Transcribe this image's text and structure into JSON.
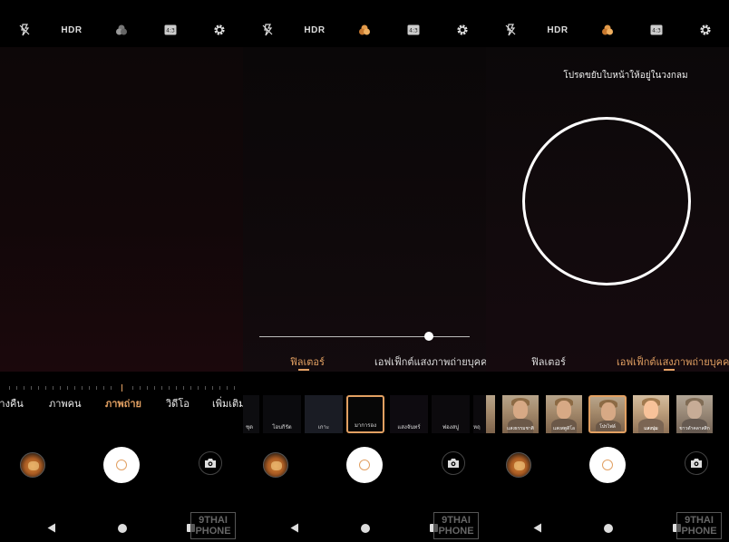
{
  "panel1": {
    "modes": [
      {
        "label": "กลางคืน",
        "active": false
      },
      {
        "label": "ภาพคน",
        "active": false
      },
      {
        "label": "ภาพถ่าย",
        "active": true
      },
      {
        "label": "วิดีโอ",
        "active": false
      },
      {
        "label": "เพิ่มเติม",
        "active": false
      }
    ]
  },
  "panel2": {
    "tabs": [
      {
        "label": "ฟิลเตอร์",
        "active": true
      },
      {
        "label": "เอฟเฟ็กต์แสงภาพถ่ายบุคคล",
        "active": false
      }
    ],
    "slider_value": 0.82,
    "filters": [
      {
        "label": "ชุด",
        "selected": false
      },
      {
        "label": "โอบกิรัต",
        "selected": false
      },
      {
        "label": "เกาะ",
        "selected": false
      },
      {
        "label": "มาการอง",
        "selected": true
      },
      {
        "label": "แสงจันทร์",
        "selected": false
      },
      {
        "label": "ฟองสบู่",
        "selected": false
      },
      {
        "label": "หฤ",
        "selected": false
      }
    ]
  },
  "panel3": {
    "hint": "โปรดขยับใบหน้าให้อยู่ในวงกลม",
    "tabs": [
      {
        "label": "ฟิลเตอร์",
        "active": false
      },
      {
        "label": "เอฟเฟ็กต์แสงภาพถ่ายบุคคล",
        "active": true
      }
    ],
    "portraits": [
      {
        "label": "",
        "selected": false
      },
      {
        "label": "แสงธรรมชาติ",
        "selected": false
      },
      {
        "label": "แสงสตูดิโอ",
        "selected": false
      },
      {
        "label": "โปรไฟล์",
        "selected": true
      },
      {
        "label": "แสงนุ่ม",
        "selected": false
      },
      {
        "label": "ขาวดำคลาสสิก",
        "selected": false
      }
    ]
  },
  "topbar": {
    "icons": [
      "flash-off-icon",
      "hdr-icon",
      "filter-effects-icon",
      "aspect-ratio-icon",
      "settings-icon"
    ],
    "hdr_text": "HDR",
    "ratio_text": "4:3"
  },
  "watermark": {
    "line1": "9THAI",
    "line2": "PHONE"
  },
  "colors": {
    "accent": "#e2a062",
    "background": "#000000"
  }
}
